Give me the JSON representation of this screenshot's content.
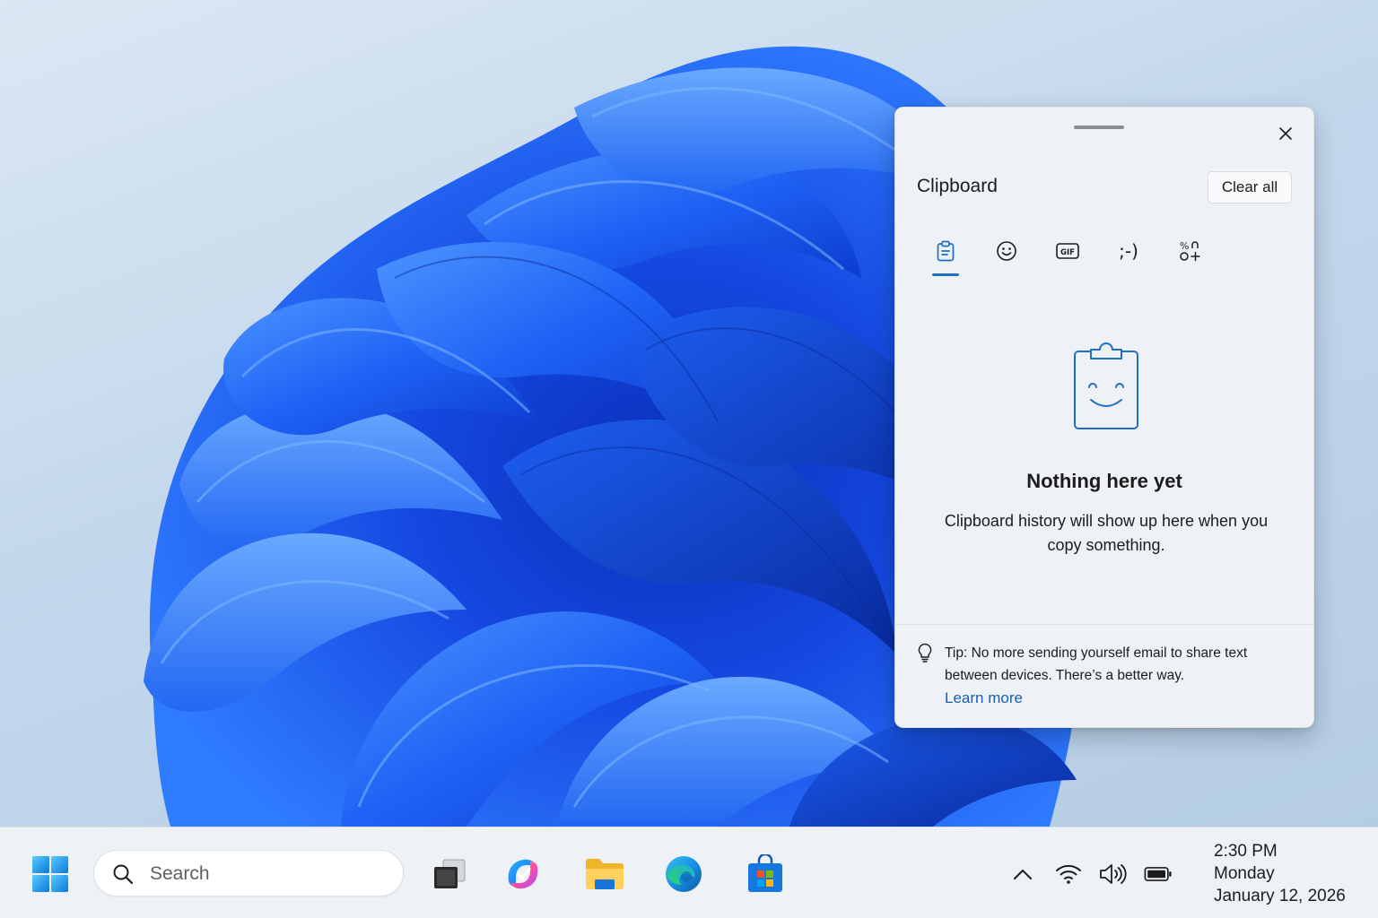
{
  "colors": {
    "accent": "#1f6fc5",
    "link": "#1a5fb4",
    "flyout_background": "#eef1f5",
    "taskbar_background": "#eef2f7",
    "wallpaper_blue": "#1a5bf2"
  },
  "clipboard": {
    "title": "Clipboard",
    "clear_all_label": "Clear all",
    "close_icon": "close-icon",
    "tabs": [
      {
        "icon": "clipboard-icon",
        "selected": true
      },
      {
        "icon": "emoji-icon",
        "selected": false
      },
      {
        "icon": "gif-icon",
        "selected": false,
        "glyph": "GIF"
      },
      {
        "icon": "kaomoji-icon",
        "selected": false,
        "glyph": ";-)"
      },
      {
        "icon": "symbols-icon",
        "selected": false
      }
    ],
    "empty_state": {
      "icon": "smiling-clipboard-icon",
      "title": "Nothing here yet",
      "description": "Clipboard history will show up here when you copy something."
    },
    "tip": {
      "icon": "lightbulb-icon",
      "text": "Tip: No more sending yourself email to share text between devices. There’s a better way.",
      "link_label": "Learn more"
    }
  },
  "taskbar": {
    "start_icon": "windows-logo-icon",
    "search": {
      "icon": "search-icon",
      "label": "Search"
    },
    "apps": [
      {
        "name": "task-view",
        "icon": "task-view-icon"
      },
      {
        "name": "copilot",
        "icon": "copilot-icon"
      },
      {
        "name": "file-explorer",
        "icon": "folder-icon"
      },
      {
        "name": "edge",
        "icon": "edge-icon"
      },
      {
        "name": "microsoft-store",
        "icon": "store-icon"
      }
    ],
    "tray": {
      "icons": [
        "chevron-up-icon",
        "wifi-icon",
        "volume-icon",
        "battery-icon"
      ],
      "time": "2:30 PM",
      "day": "Monday",
      "date": "January 12, 2026"
    }
  }
}
